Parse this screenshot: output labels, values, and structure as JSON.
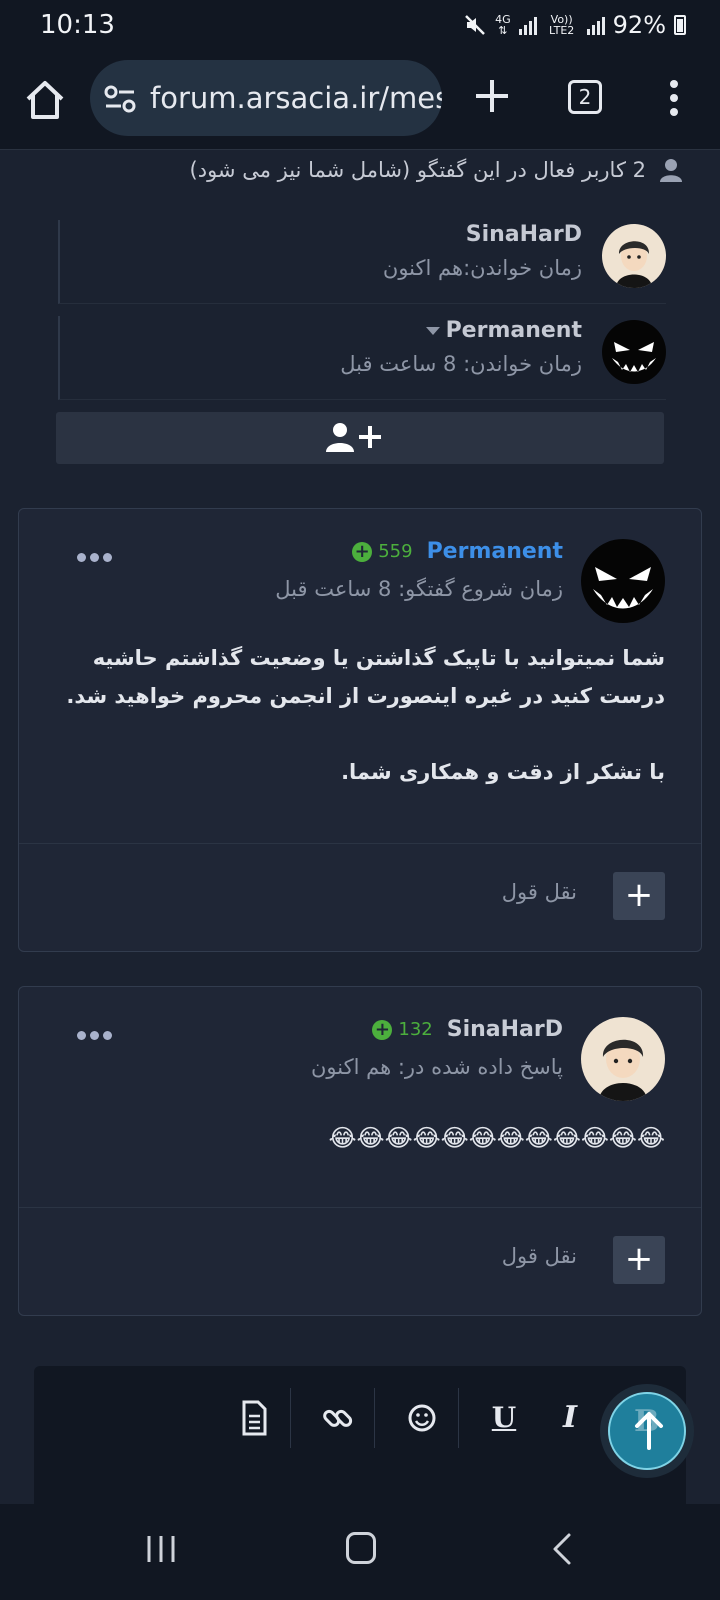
{
  "status_bar": {
    "time": "10:13",
    "network_type": "4G",
    "volte_label": "Vo)) LTE2",
    "battery": "92%",
    "icons": [
      "mute-icon",
      "signal-icon",
      "battery-icon"
    ]
  },
  "browser": {
    "url": "forum.arsacia.ir/mes",
    "tab_count": "2",
    "icons": [
      "home-icon",
      "site-settings-icon",
      "new-tab-icon",
      "tab-switcher-icon",
      "more-vert-icon"
    ]
  },
  "participants": {
    "header": "2 کاربر فعال در این گفتگو (شامل شما نیز می شود)",
    "items": [
      {
        "name": "SinaHarD",
        "meta": "زمان خواندن:هم اکنون"
      },
      {
        "name": "Permanent",
        "meta": "زمان خواندن: 8 ساعت قبل"
      }
    ]
  },
  "messages": [
    {
      "author": "Permanent",
      "author_color": "#3d8fe8",
      "reputation": "559",
      "meta": "زمان شروع گفتگو: 8 ساعت قبل",
      "body": [
        "شما نمیتوانید با تاپیک گذاشتن یا وضعیت گذاشتم حاشیه درست کنید در غیره اینصورت از انجمن محروم خواهید شد.",
        "با تشکر از دقت و همکاری شما."
      ],
      "quote_label": "نقل قول"
    },
    {
      "author": "SinaHarD",
      "author_color": "#c9cdd6",
      "reputation": "132",
      "meta": "پاسخ داده شده در: هم اکنون",
      "body": [
        "😂😂😂😂😂😂😂😂😂😂😂😂"
      ],
      "quote_label": "نقل قول"
    }
  ],
  "editor": {
    "tools": [
      "document-icon",
      "link-icon",
      "emoji-icon",
      "underline-icon",
      "italic-icon",
      "bold-icon"
    ],
    "underline_label": "U",
    "italic_label": "I",
    "bold_label": "B"
  },
  "colors": {
    "accent_green": "#4caf3d",
    "accent_blue": "#3d8fe8",
    "scroll_button": "#1f7f9c"
  }
}
